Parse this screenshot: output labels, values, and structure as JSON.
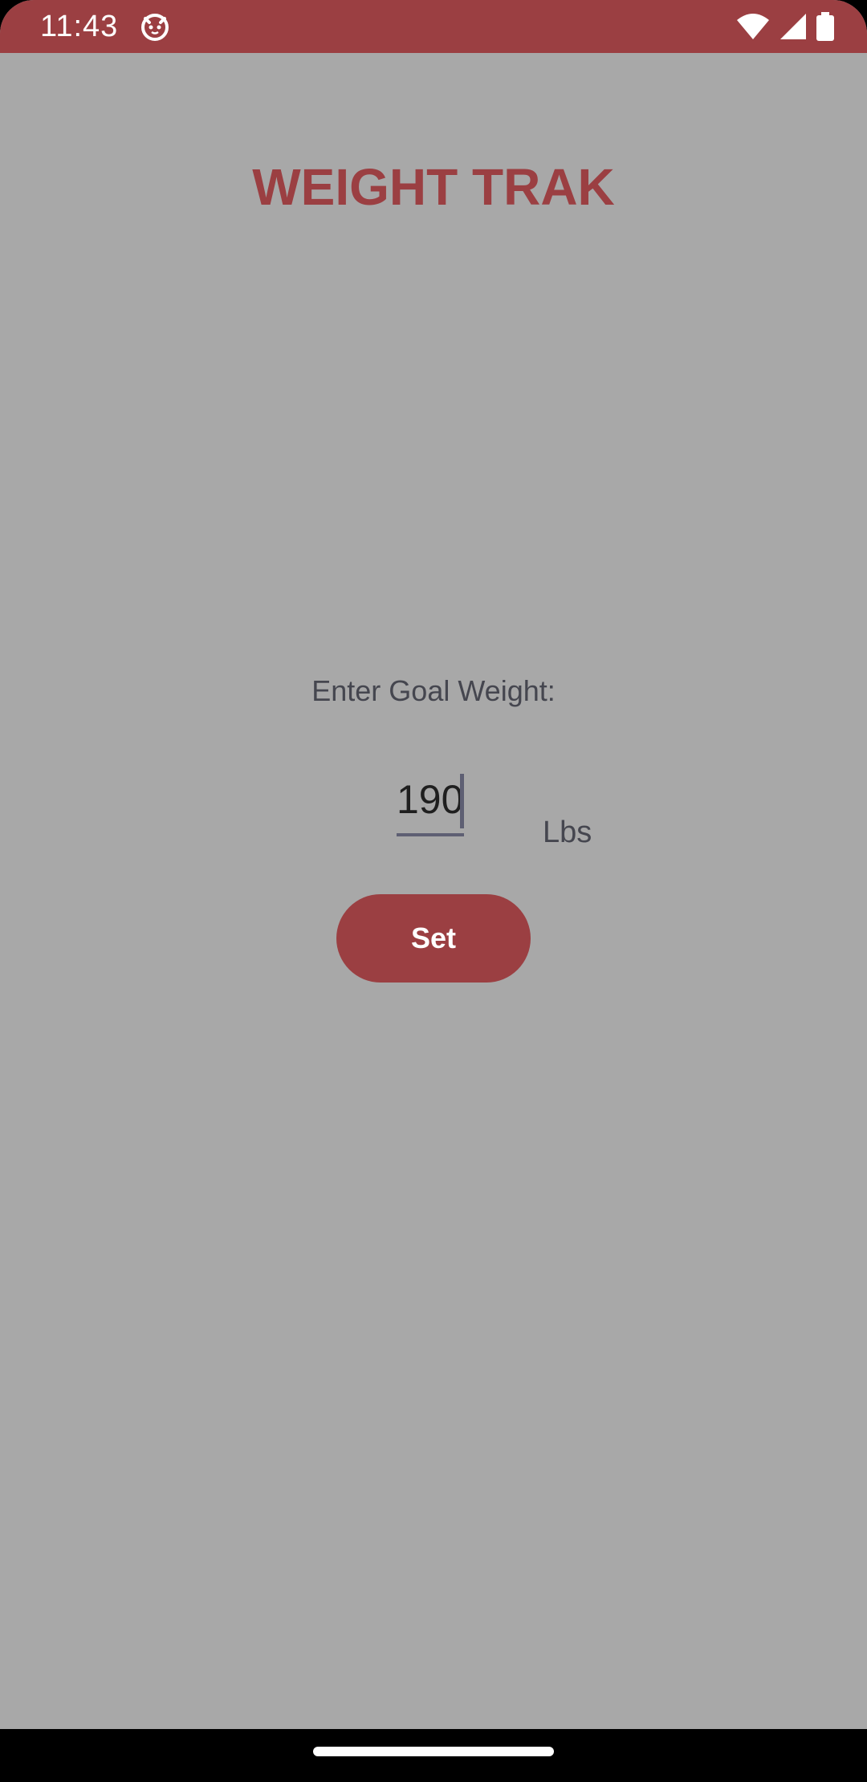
{
  "status_bar": {
    "time": "11:43",
    "app_icon": "cat-face-icon",
    "icons": [
      "wifi-icon",
      "cellular-signal-icon",
      "battery-icon"
    ],
    "color": "#9b3f42"
  },
  "app": {
    "title": "WEIGHT TRAK",
    "goal_prompt": "Enter Goal Weight:",
    "weight_input": {
      "value": "190",
      "unit": "Lbs"
    },
    "set_button_label": "Set"
  },
  "colors": {
    "accent": "#9b3f42",
    "background": "#a8a8a8",
    "text": "#45464f",
    "underline": "#5e5f73"
  },
  "navigation": {
    "home_handle": "home-indicator"
  }
}
